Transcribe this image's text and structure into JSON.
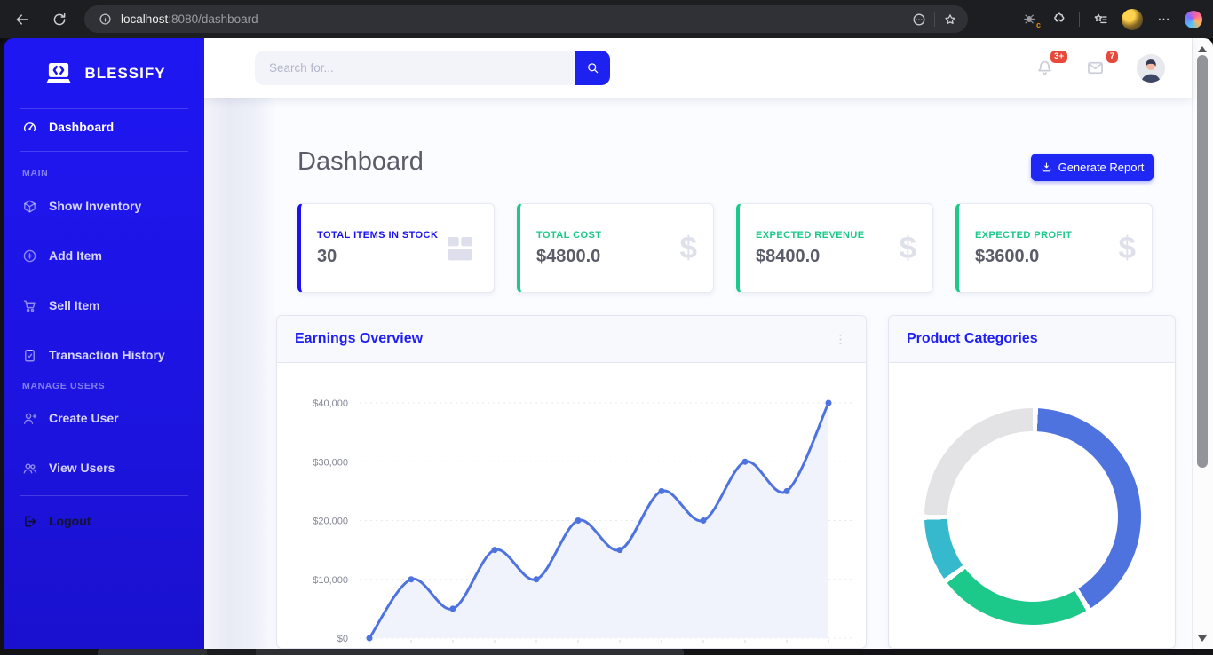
{
  "browser": {
    "url_host": "localhost",
    "url_path": ":8080/dashboard",
    "toolbar_icons": [
      "back-arrow-icon",
      "refresh-icon",
      "site-info-icon",
      "circled-ellipsis-icon",
      "bookmark-star-icon",
      "adblocker-extension-icon",
      "extensions-puzzle-icon",
      "favorites-list-icon",
      "browser-profile-avatar",
      "more-options-icon",
      "copilot-icon"
    ]
  },
  "sidebar": {
    "brand": "BLESSIFY",
    "entries": [
      {
        "type": "item",
        "label": "Dashboard",
        "icon": "tachometer-icon",
        "active": true
      },
      {
        "type": "divider"
      },
      {
        "type": "heading",
        "label": "MAIN"
      },
      {
        "type": "item",
        "label": "Show Inventory",
        "icon": "box-cube-icon"
      },
      {
        "type": "item",
        "label": "Add Item",
        "icon": "plus-circle-icon"
      },
      {
        "type": "item",
        "label": "Sell Item",
        "icon": "cart-icon"
      },
      {
        "type": "item",
        "label": "Transaction History",
        "icon": "clipboard-check-icon"
      },
      {
        "type": "heading",
        "label": "MANAGE USERS"
      },
      {
        "type": "item",
        "label": "Create User",
        "icon": "user-plus-icon"
      },
      {
        "type": "item",
        "label": "View Users",
        "icon": "users-icon"
      },
      {
        "type": "divider"
      },
      {
        "type": "item",
        "label": "Logout",
        "icon": "logout-icon",
        "dark": true
      }
    ]
  },
  "topbar": {
    "search_placeholder": "Search for...",
    "alerts_badge": "3+",
    "messages_badge": "7",
    "icons": [
      "bell-icon",
      "envelope-icon",
      "user-avatar"
    ]
  },
  "page": {
    "title": "Dashboard",
    "report_button": "Generate Report"
  },
  "stats": [
    {
      "label": "TOTAL ITEMS IN STOCK",
      "value": "30",
      "accent": "#1a10f0",
      "icon": "box-icon"
    },
    {
      "label": "TOTAL COST",
      "value": "$4800.0",
      "accent": "#1cc88a",
      "icon": "dollar-icon"
    },
    {
      "label": "EXPECTED REVENUE",
      "value": "$8400.0",
      "accent": "#1cc88a",
      "icon": "dollar-icon"
    },
    {
      "label": "EXPECTED PROFIT",
      "value": "$3600.0",
      "accent": "#1cc88a",
      "icon": "dollar-icon"
    }
  ],
  "chart_data": [
    {
      "type": "line",
      "title": "Earnings Overview",
      "x": [
        1,
        2,
        3,
        4,
        5,
        6,
        7,
        8,
        9,
        10,
        11,
        12
      ],
      "x_labels_visible": false,
      "values": [
        0,
        10000,
        5000,
        15000,
        10000,
        20000,
        15000,
        25000,
        20000,
        30000,
        25000,
        40000
      ],
      "ylim": [
        0,
        40000
      ],
      "yticks": [
        "$0",
        "$10,000",
        "$20,000",
        "$30,000",
        "$40,000"
      ],
      "line_color": "#4e73df",
      "fill_color": "#f0f3fb",
      "grid": "dotted-horizontal",
      "legend": "none"
    },
    {
      "type": "pie",
      "style": "doughnut",
      "title": "Product Categories",
      "legend": "none",
      "labels_visible": false,
      "segments": [
        {
          "color": "#4e73df",
          "percent": 41
        },
        {
          "color": "#1cc88a",
          "percent": 23.5
        },
        {
          "color": "#36b9cc",
          "percent": 10
        },
        {
          "color": "#e3e3e6",
          "percent": 25.5
        }
      ]
    }
  ],
  "theme": {
    "accent_blue": "#1e1ef5",
    "success_green": "#1cc88a",
    "teal": "#36b9cc",
    "badge_red": "#e74a3b",
    "chart_blue": "#4e73df",
    "text_dark": "#5a5c69",
    "text_muted": "#858796"
  }
}
